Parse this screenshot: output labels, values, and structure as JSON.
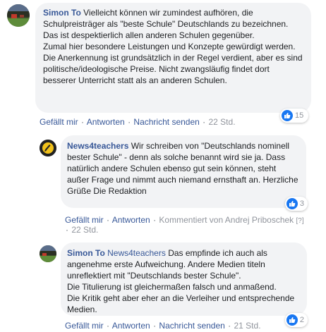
{
  "comments": [
    {
      "author": "Simon To",
      "text": "Vielleicht können wir zumindest aufhören, die Schulpreisträger als \"beste Schule\" Deutschlands zu bezeichnen. Das ist despektierlich allen anderen Schulen gegenüber.\nZumal hier besondere Leistungen und Konzepte gewürdigt werden. Die Anerkennung ist grundsätzlich in der Regel verdient, aber es sind politische/ideologische Preise. Nicht zwangsläufig findet dort besserer Unterricht statt als an anderen Schulen.",
      "actions": {
        "like": "Gefällt mir",
        "reply": "Antworten",
        "message": "Nachricht senden",
        "time": "22 Std."
      },
      "reaction": {
        "icon": "like-icon",
        "count": "15"
      }
    },
    {
      "author": "News4teachers",
      "text": "Wir schreiben von \"Deutschlands nominell bester Schule\" - denn als solche benannt wird sie ja. Dass natürlich andere Schulen ebenso gut sein können, steht außer Frage und nimmt auch niemand ernsthaft an. Herzliche Grüße Die Redaktion",
      "actions": {
        "like": "Gefällt mir",
        "reply": "Antworten",
        "commented_by": "Kommentiert von Andrej Priboschek",
        "help": "[?]",
        "time": "22 Std."
      },
      "reaction": {
        "icon": "like-icon",
        "count": "3"
      }
    },
    {
      "author": "Simon To",
      "mention": "News4teachers",
      "text": "Das empfinde ich auch als angenehme erste Aufweichung. Andere Medien titeln unreflektiert mit \"Deutschlands bester Schule\".\nDie Titulierung ist gleichermaßen falsch und anmaßend.\nDie Kritik geht aber eher an die Verleiher und entsprechende Medien.",
      "actions": {
        "like": "Gefällt mir",
        "reply": "Antworten",
        "message": "Nachricht senden",
        "time": "21 Std."
      },
      "reaction": {
        "icon": "like-icon",
        "count": "2"
      }
    }
  ],
  "separator": "·"
}
